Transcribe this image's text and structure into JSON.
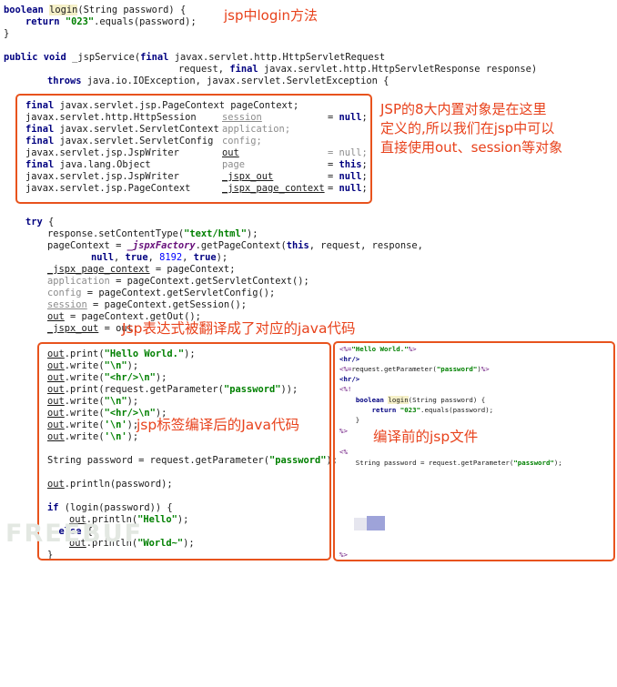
{
  "annotations": {
    "login_method": "jsp中login方法",
    "implicit_objects": [
      "JSP的8大内置对象是在这里",
      "定义的,所以我们在jsp中可以",
      "直接使用out、session等对象"
    ],
    "expression": "Jsp表达式被翻译成了对应的java代码",
    "tag_compiled": "jsp标签编译后的Java代码",
    "jsp_source": "编译前的jsp文件"
  },
  "code": {
    "login": [
      "boolean login(String password) {",
      "  return \"023\".equals(password);",
      "}"
    ],
    "service": [
      "public void _jspService(final javax.servlet.http.HttpServletRequest",
      "request, final javax.servlet.http.HttpServletResponse response)",
      "throws java.io.IOException, javax.servlet.ServletException {"
    ],
    "declarations": [
      [
        "final javax.servlet.jsp.PageContext",
        "pageContext;",
        ""
      ],
      [
        "javax.servlet.http.HttpSession",
        "session",
        "= null;"
      ],
      [
        "final javax.servlet.ServletContext",
        "application;",
        ""
      ],
      [
        "final javax.servlet.ServletConfig",
        "config;",
        ""
      ],
      [
        "javax.servlet.jsp.JspWriter",
        "out",
        "= null;"
      ],
      [
        "final java.lang.Object",
        "page",
        "= this;"
      ],
      [
        "javax.servlet.jsp.JspWriter",
        "_jspx_out",
        "= null;"
      ],
      [
        "javax.servlet.jsp.PageContext",
        "_jspx_page_context",
        "= null;"
      ]
    ],
    "try_block": [
      "try {",
      "response.setContentType(\"text/html\");",
      "pageContext = _jspxFactory.getPageContext(this, request, response,",
      "null, true, 8192, true);",
      "_jspx_page_context = pageContext;",
      "application = pageContext.getServletContext();",
      "config = pageContext.getServletConfig();",
      "session = pageContext.getSession();",
      "out = pageContext.getOut();",
      "_jspx_out = out;"
    ],
    "body": [
      "out.print(\"Hello World.\");",
      "out.write(\"\\n\");",
      "out.write(\"<hr/>\\n\");",
      "out.print(request.getParameter(\"password\"));",
      "out.write(\"\\n\");",
      "out.write(\"<hr/>\\n\");",
      "out.write('\\n');",
      "out.write('\\n');",
      "",
      "String password = request.getParameter(\"password\");",
      "",
      "out.println(password);",
      "",
      "if (login(password)) {",
      "  out.println(\"Hello\");",
      "} else {",
      "  out.println(\"World~\");",
      "}"
    ],
    "jsp": [
      "<%=\"Hello World.\"%>",
      "<hr/>",
      "<%=request.getParameter(\"password\")%>",
      "<hr/>",
      "<%!",
      "    boolean login(String password) {",
      "        return \"023\".equals(password);",
      "    }",
      "%>",
      "",
      "<%",
      "    String password = request.getParameter(\"password\");"
    ],
    "jsp_last": "%>"
  },
  "watermark": "FREEBUF",
  "colors": {
    "accent": "#e8531d",
    "keyword": "#000080",
    "string": "#008000"
  }
}
